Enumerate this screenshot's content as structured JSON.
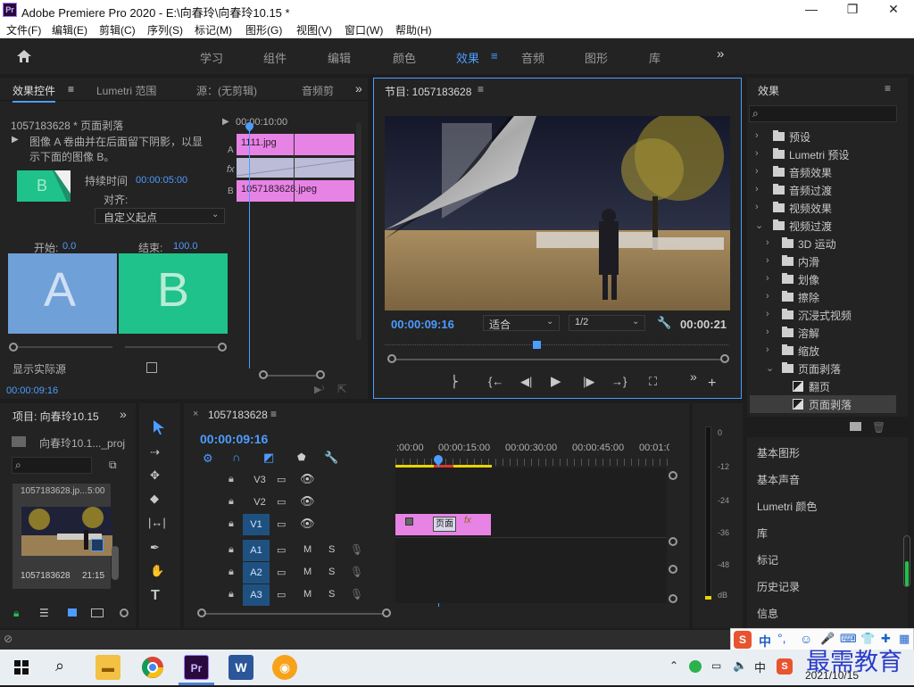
{
  "window": {
    "title": "Adobe Premiere Pro 2020 - E:\\向春玲\\向春玲10.15 *",
    "app_icon": "Pr",
    "controls": [
      "—",
      "❐",
      "✕"
    ]
  },
  "menu": [
    "文件(F)",
    "编辑(E)",
    "剪辑(C)",
    "序列(S)",
    "标记(M)",
    "图形(G)",
    "视图(V)",
    "窗口(W)",
    "帮助(H)"
  ],
  "workspaces": {
    "items": [
      "学习",
      "组件",
      "编辑",
      "颜色",
      "效果",
      "音频",
      "图形",
      "库"
    ],
    "active": "效果"
  },
  "effect_controls": {
    "tabs": [
      "效果控件",
      "Lumetri 范围",
      "源：(无剪辑)",
      "音频剪"
    ],
    "clip_title": "1057183628 * 页面剥落",
    "timecode_top": "00:00:10:00",
    "description": "图像 A 卷曲并在后面留下阴影，以显示下面的图像 B。",
    "duration_label": "持续时间",
    "duration_value": "00:00:05:00",
    "align_label": "对齐:",
    "align_value": "自定义起点",
    "start_label": "开始:",
    "start_value": "0.0",
    "end_label": "结束:",
    "end_value": "100.0",
    "big_a": "A",
    "big_b": "B",
    "thumb_b": "B",
    "show_actual_label": "显示实际源",
    "track_a_label": "A",
    "track_b_label": "B",
    "fx_label": "fx",
    "clip_a": "1111.jpg",
    "clip_b": "1057183628.jpeg",
    "bottom_timecode": "00:00:09:16"
  },
  "program": {
    "tab": "节目: 1057183628",
    "timecode": "00:00:09:16",
    "fit": "适合",
    "quality": "1/2",
    "duration": "00:00:21"
  },
  "effects": {
    "title": "效果",
    "search_placeholder": "",
    "items": [
      {
        "label": "预设",
        "level": 0,
        "expanded": false
      },
      {
        "label": "Lumetri 预设",
        "level": 0,
        "expanded": false
      },
      {
        "label": "音频效果",
        "level": 0,
        "expanded": false
      },
      {
        "label": "音频过渡",
        "level": 0,
        "expanded": false
      },
      {
        "label": "视频效果",
        "level": 0,
        "expanded": false
      },
      {
        "label": "视频过渡",
        "level": 0,
        "expanded": true
      },
      {
        "label": "3D 运动",
        "level": 1,
        "expanded": false
      },
      {
        "label": "内滑",
        "level": 1,
        "expanded": false
      },
      {
        "label": "划像",
        "level": 1,
        "expanded": false
      },
      {
        "label": "擦除",
        "level": 1,
        "expanded": false
      },
      {
        "label": "沉浸式视频",
        "level": 1,
        "expanded": false
      },
      {
        "label": "溶解",
        "level": 1,
        "expanded": false
      },
      {
        "label": "缩放",
        "level": 1,
        "expanded": false
      },
      {
        "label": "页面剥落",
        "level": 1,
        "expanded": true
      },
      {
        "label": "翻页",
        "level": 2,
        "expanded": false
      },
      {
        "label": "页面剥落",
        "level": 2,
        "expanded": false,
        "selected": true
      }
    ],
    "side_panels": [
      "基本图形",
      "基本声音",
      "Lumetri 颜色",
      "库",
      "标记",
      "历史记录",
      "信息"
    ]
  },
  "project": {
    "tab": "项目: 向春玲10.15",
    "file": "向春玲10.1..._proj",
    "thumb_name_top": "1057183628.jp...",
    "thumb_duration_top": "5:00",
    "thumb_name": "1057183628",
    "thumb_duration": "21:15"
  },
  "timeline": {
    "tab": "1057183628",
    "timecode": "00:00:09:16",
    "ruler": [
      ":00:00",
      "00:00:15:00",
      "00:00:30:00",
      "00:00:45:00",
      "00:01:0"
    ],
    "video_tracks": [
      "V3",
      "V2",
      "V1"
    ],
    "audio_tracks": [
      "A1",
      "A2",
      "A3"
    ],
    "track_m": "M",
    "track_s": "S",
    "clip_label": "页面",
    "clip_fx": "fx",
    "meter_labels": [
      "0",
      "-12",
      "-24",
      "-36",
      "-48",
      "dB"
    ]
  },
  "ime": {
    "lang": "中",
    "watermark": "最需教育"
  },
  "taskbar": {
    "date": "2021/10/15",
    "lang": "中"
  },
  "colors": {
    "accent": "#4d9cff",
    "clip_pink": "#e883e6",
    "card_a": "#6fa0d8",
    "card_b": "#1fc28a"
  }
}
